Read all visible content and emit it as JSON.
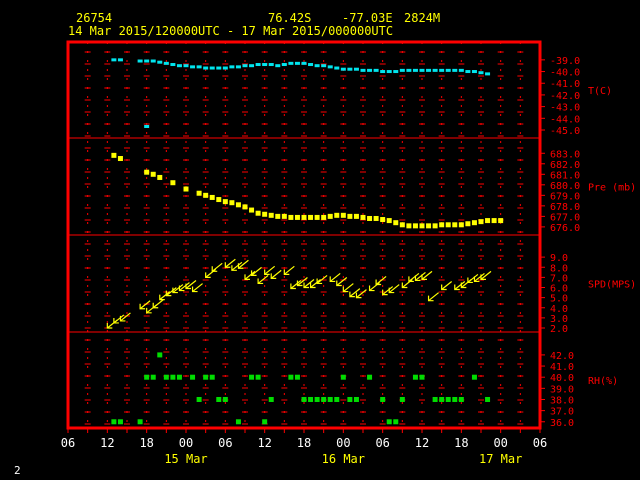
{
  "header": {
    "station": "26754",
    "lat": "76.42S",
    "lon": "-77.03E",
    "elev": "2824M",
    "range": "14 Mar 2015/120000UTC - 17 Mar 2015/000000UTC"
  },
  "footer": {
    "page": "2"
  },
  "colors": {
    "frame": "#ff0000",
    "header_text": "#ffff00",
    "temp": "#00e5ee",
    "pressure": "#ffff00",
    "wind": "#ffff00",
    "rh": "#00dd00",
    "date_text": "#ffff00",
    "page_text": "#ffffff"
  },
  "chart_data": {
    "type": "scatter",
    "x_axis": {
      "unit": "hours since 14 Mar 2015 06UTC",
      "range": [
        0,
        72
      ],
      "tick_step": 3,
      "labels": [
        {
          "hour": 0,
          "text": "06"
        },
        {
          "hour": 6,
          "text": "12"
        },
        {
          "hour": 12,
          "text": "18"
        },
        {
          "hour": 18,
          "text": "00"
        },
        {
          "hour": 24,
          "text": "06"
        },
        {
          "hour": 30,
          "text": "12"
        },
        {
          "hour": 36,
          "text": "18"
        },
        {
          "hour": 42,
          "text": "00"
        },
        {
          "hour": 48,
          "text": "06"
        },
        {
          "hour": 54,
          "text": "12"
        },
        {
          "hour": 60,
          "text": "18"
        },
        {
          "hour": 66,
          "text": "00"
        },
        {
          "hour": 72,
          "text": "06"
        }
      ],
      "dates": [
        {
          "hour": 18,
          "text": "15 Mar"
        },
        {
          "hour": 42,
          "text": "16 Mar"
        },
        {
          "hour": 66,
          "text": "17 Mar"
        }
      ]
    },
    "panels": [
      {
        "name": "T(C)",
        "ylim": [
          -45,
          -38.5
        ],
        "ticks": [
          "-39.0",
          "-40.0",
          "-41.0",
          "-42.0",
          "-43.0",
          "-44.0",
          "-45.0"
        ],
        "tick_values": [
          -39,
          -40,
          -41,
          -42,
          -43,
          -44,
          -45
        ],
        "marker": "dot",
        "points": [
          [
            7,
            -39.0
          ],
          [
            8,
            -39.0
          ],
          [
            11,
            -39.1
          ],
          [
            12,
            -39.1
          ],
          [
            13,
            -39.1
          ],
          [
            14,
            -39.2
          ],
          [
            15,
            -39.3
          ],
          [
            16,
            -39.4
          ],
          [
            17,
            -39.5
          ],
          [
            18,
            -39.5
          ],
          [
            19,
            -39.6
          ],
          [
            20,
            -39.6
          ],
          [
            21,
            -39.7
          ],
          [
            22,
            -39.7
          ],
          [
            23,
            -39.7
          ],
          [
            24,
            -39.7
          ],
          [
            25,
            -39.6
          ],
          [
            26,
            -39.6
          ],
          [
            27,
            -39.5
          ],
          [
            28,
            -39.5
          ],
          [
            29,
            -39.4
          ],
          [
            30,
            -39.4
          ],
          [
            31,
            -39.4
          ],
          [
            32,
            -39.5
          ],
          [
            33,
            -39.4
          ],
          [
            34,
            -39.3
          ],
          [
            35,
            -39.3
          ],
          [
            36,
            -39.3
          ],
          [
            37,
            -39.4
          ],
          [
            38,
            -39.5
          ],
          [
            39,
            -39.5
          ],
          [
            40,
            -39.6
          ],
          [
            41,
            -39.7
          ],
          [
            42,
            -39.8
          ],
          [
            43,
            -39.8
          ],
          [
            44,
            -39.8
          ],
          [
            45,
            -39.9
          ],
          [
            46,
            -39.9
          ],
          [
            47,
            -39.9
          ],
          [
            48,
            -40.0
          ],
          [
            49,
            -40.0
          ],
          [
            50,
            -40.0
          ],
          [
            51,
            -39.9
          ],
          [
            52,
            -39.9
          ],
          [
            53,
            -39.9
          ],
          [
            54,
            -39.9
          ],
          [
            55,
            -39.9
          ],
          [
            56,
            -39.9
          ],
          [
            57,
            -39.9
          ],
          [
            58,
            -39.9
          ],
          [
            59,
            -39.9
          ],
          [
            60,
            -39.9
          ],
          [
            61,
            -40.0
          ],
          [
            62,
            -40.0
          ],
          [
            63,
            -40.1
          ],
          [
            64,
            -40.2
          ],
          [
            12,
            -44.7
          ]
        ]
      },
      {
        "name": "Pre (mb)",
        "ylim": [
          675.8,
          683.5
        ],
        "ticks": [
          "683.0",
          "682.0",
          "681.0",
          "680.0",
          "679.0",
          "678.0",
          "677.0",
          "676.0"
        ],
        "tick_values": [
          683,
          682,
          681,
          680,
          679,
          678,
          677,
          676
        ],
        "marker": "square",
        "points": [
          [
            7,
            682.8
          ],
          [
            8,
            682.5
          ],
          [
            12,
            681.2
          ],
          [
            13,
            681.0
          ],
          [
            14,
            680.7
          ],
          [
            16,
            680.2
          ],
          [
            18,
            679.6
          ],
          [
            20,
            679.2
          ],
          [
            21,
            679.0
          ],
          [
            22,
            678.8
          ],
          [
            23,
            678.6
          ],
          [
            24,
            678.4
          ],
          [
            25,
            678.3
          ],
          [
            26,
            678.1
          ],
          [
            27,
            677.9
          ],
          [
            28,
            677.6
          ],
          [
            29,
            677.3
          ],
          [
            30,
            677.2
          ],
          [
            31,
            677.1
          ],
          [
            32,
            677.0
          ],
          [
            33,
            677.0
          ],
          [
            34,
            676.9
          ],
          [
            35,
            676.9
          ],
          [
            36,
            676.9
          ],
          [
            37,
            676.9
          ],
          [
            38,
            676.9
          ],
          [
            39,
            676.9
          ],
          [
            40,
            677.0
          ],
          [
            41,
            677.1
          ],
          [
            42,
            677.1
          ],
          [
            43,
            677.0
          ],
          [
            44,
            677.0
          ],
          [
            45,
            676.9
          ],
          [
            46,
            676.8
          ],
          [
            47,
            676.8
          ],
          [
            48,
            676.7
          ],
          [
            49,
            676.6
          ],
          [
            50,
            676.4
          ],
          [
            51,
            676.2
          ],
          [
            52,
            676.1
          ],
          [
            53,
            676.1
          ],
          [
            54,
            676.1
          ],
          [
            55,
            676.1
          ],
          [
            56,
            676.1
          ],
          [
            57,
            676.2
          ],
          [
            58,
            676.2
          ],
          [
            59,
            676.2
          ],
          [
            60,
            676.2
          ],
          [
            61,
            676.3
          ],
          [
            62,
            676.4
          ],
          [
            63,
            676.5
          ],
          [
            64,
            676.6
          ],
          [
            65,
            676.6
          ],
          [
            66,
            676.6
          ]
        ]
      },
      {
        "name": "SPD(MPS)",
        "ylim": [
          2,
          10
        ],
        "ticks": [
          "9.0",
          "8.0",
          "7.0",
          "6.0",
          "5.0",
          "4.0",
          "3.0",
          "2.0"
        ],
        "tick_values": [
          9,
          8,
          7,
          6,
          5,
          4,
          3,
          2
        ],
        "marker": "wind",
        "points": [
          [
            6,
            2.0
          ],
          [
            7,
            2.5
          ],
          [
            8,
            2.7
          ],
          [
            11,
            3.9
          ],
          [
            12,
            3.5
          ],
          [
            13,
            4.0
          ],
          [
            14,
            4.8
          ],
          [
            15,
            5.2
          ],
          [
            16,
            5.5
          ],
          [
            17,
            5.7
          ],
          [
            18,
            5.9
          ],
          [
            19,
            5.6
          ],
          [
            21,
            7.0
          ],
          [
            22,
            7.6
          ],
          [
            24,
            8.0
          ],
          [
            25,
            7.7
          ],
          [
            26,
            7.9
          ],
          [
            27,
            6.8
          ],
          [
            28,
            7.2
          ],
          [
            29,
            6.4
          ],
          [
            30,
            7.3
          ],
          [
            31,
            6.9
          ],
          [
            33,
            7.3
          ],
          [
            34,
            5.9
          ],
          [
            35,
            6.2
          ],
          [
            36,
            6.0
          ],
          [
            37,
            6.0
          ],
          [
            38,
            6.4
          ],
          [
            40,
            6.6
          ],
          [
            41,
            6.2
          ],
          [
            42,
            5.6
          ],
          [
            43,
            5.1
          ],
          [
            44,
            5.0
          ],
          [
            46,
            5.7
          ],
          [
            47,
            6.3
          ],
          [
            48,
            5.3
          ],
          [
            49,
            5.5
          ],
          [
            51,
            6.0
          ],
          [
            52,
            6.6
          ],
          [
            53,
            6.7
          ],
          [
            54,
            6.8
          ],
          [
            55,
            4.7
          ],
          [
            57,
            5.8
          ],
          [
            59,
            5.8
          ],
          [
            60,
            6.0
          ],
          [
            61,
            6.5
          ],
          [
            62,
            6.6
          ],
          [
            63,
            6.8
          ]
        ]
      },
      {
        "name": "RH(%)",
        "ylim": [
          35.8,
          42.8
        ],
        "ticks": [
          "42.0",
          "41.0",
          "40.0",
          "39.0",
          "38.0",
          "37.0",
          "36.0"
        ],
        "tick_values": [
          42,
          41,
          40,
          39,
          38,
          37,
          36
        ],
        "marker": "square",
        "points": [
          [
            12,
            40
          ],
          [
            13,
            40
          ],
          [
            14,
            42
          ],
          [
            15,
            40
          ],
          [
            16,
            40
          ],
          [
            17,
            40
          ],
          [
            19,
            40
          ],
          [
            20,
            38
          ],
          [
            21,
            40
          ],
          [
            22,
            40
          ],
          [
            23,
            38
          ],
          [
            24,
            38
          ],
          [
            26,
            36
          ],
          [
            28,
            40
          ],
          [
            29,
            40
          ],
          [
            30,
            36
          ],
          [
            31,
            38
          ],
          [
            34,
            40
          ],
          [
            35,
            40
          ],
          [
            36,
            38
          ],
          [
            37,
            38
          ],
          [
            38,
            38
          ],
          [
            39,
            38
          ],
          [
            40,
            38
          ],
          [
            41,
            38
          ],
          [
            42,
            40
          ],
          [
            43,
            38
          ],
          [
            44,
            38
          ],
          [
            46,
            40
          ],
          [
            48,
            38
          ],
          [
            49,
            36
          ],
          [
            50,
            36
          ],
          [
            51,
            38
          ],
          [
            53,
            40
          ],
          [
            54,
            40
          ],
          [
            56,
            38
          ],
          [
            57,
            38
          ],
          [
            58,
            38
          ],
          [
            59,
            38
          ],
          [
            60,
            38
          ],
          [
            62,
            40
          ],
          [
            64,
            38
          ],
          [
            7,
            36
          ],
          [
            8,
            36
          ],
          [
            11,
            36
          ]
        ]
      }
    ]
  }
}
